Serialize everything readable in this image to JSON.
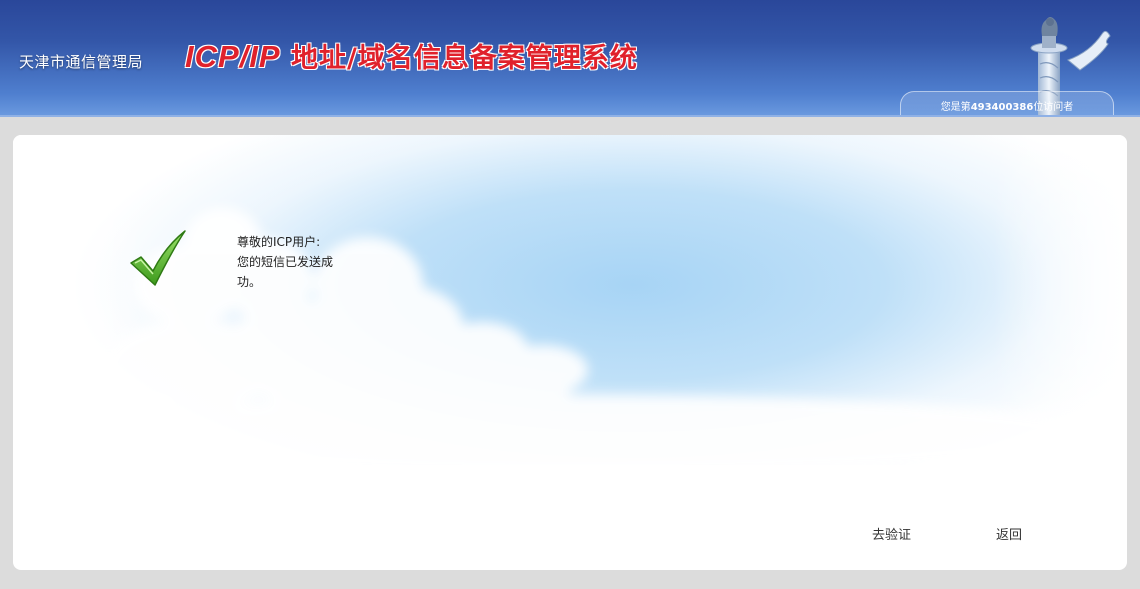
{
  "header": {
    "bureau": "天津市通信管理局",
    "title_prefix": "ICP/IP",
    "title_suffix": " 地址/域名信息备案管理系统",
    "visitor_prefix": "您是第",
    "visitor_count": "493400386",
    "visitor_suffix": "位访问者"
  },
  "message": {
    "greeting": "尊敬的ICP用户:",
    "line1": "您的短信已发送成",
    "line2": "功。"
  },
  "actions": {
    "verify": "去验证",
    "back": "返回"
  },
  "colors": {
    "title_red": "#e0212b",
    "header_blue": "#3356a8",
    "check_green": "#5fb830"
  }
}
